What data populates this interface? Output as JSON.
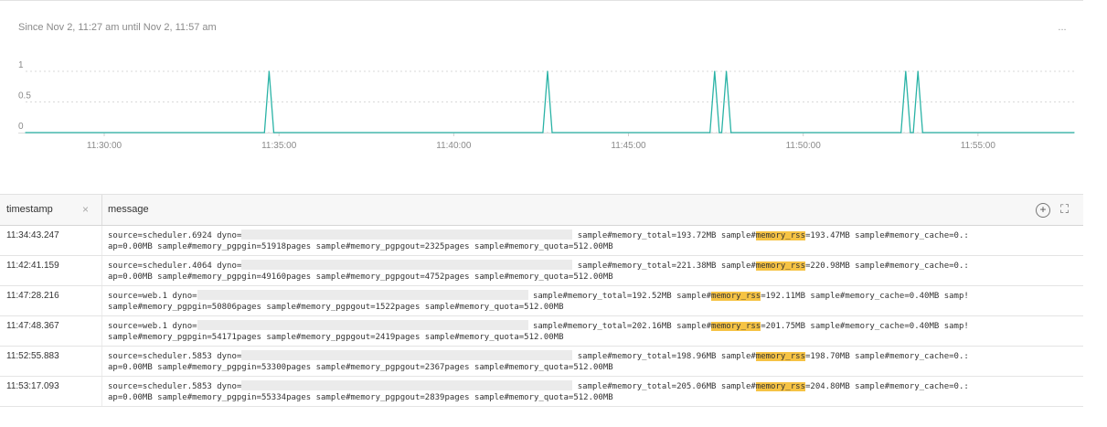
{
  "header": {
    "time_range": "Since Nov 2, 11:27 am until Nov 2, 11:57 am",
    "more_label": "..."
  },
  "chart_data": {
    "type": "line",
    "y_ticks": [
      "1",
      "0.5",
      "0"
    ],
    "x_ticks": [
      "11:30:00",
      "11:35:00",
      "11:40:00",
      "11:45:00",
      "11:50:00",
      "11:55:00"
    ],
    "ylim": [
      0,
      1
    ],
    "grid": true,
    "series_color": "#2ab3a6",
    "x": [
      "11:27:45",
      "11:34:35",
      "11:34:43",
      "11:34:51",
      "11:42:33",
      "11:42:41",
      "11:42:49",
      "11:47:20",
      "11:47:28",
      "11:47:36",
      "11:47:40",
      "11:47:48",
      "11:47:56",
      "11:52:48",
      "11:52:56",
      "11:53:04",
      "11:53:09",
      "11:53:17",
      "11:53:25",
      "11:57:45"
    ],
    "values": [
      0,
      0,
      1,
      0,
      0,
      1,
      0,
      0,
      1,
      0,
      0,
      1,
      0,
      0,
      1,
      0,
      0,
      1,
      0,
      0
    ]
  },
  "table": {
    "columns": {
      "timestamp": "timestamp",
      "remove": "×",
      "message": "message"
    },
    "add_label": "+",
    "expand_label": "⛶",
    "rows": [
      {
        "timestamp": "11:34:43.247",
        "l1_start": "source=scheduler.6924 dyno=",
        "l1_mid": " sample#memory_total=193.72MB sample#",
        "key": "memory_rss",
        "l1_end": "=193.47MB sample#memory_cache=0.:",
        "l2": "ap=0.00MB sample#memory_pgpgin=51918pages sample#memory_pgpgout=2325pages sample#memory_quota=512.00MB"
      },
      {
        "timestamp": "11:42:41.159",
        "l1_start": "source=scheduler.4064 dyno=",
        "l1_mid": " sample#memory_total=221.38MB sample#",
        "key": "memory_rss",
        "l1_end": "=220.98MB sample#memory_cache=0.:",
        "l2": "ap=0.00MB sample#memory_pgpgin=49160pages sample#memory_pgpgout=4752pages sample#memory_quota=512.00MB"
      },
      {
        "timestamp": "11:47:28.216",
        "l1_start": "source=web.1 dyno=",
        "l1_mid": " sample#memory_total=192.52MB sample#",
        "key": "memory_rss",
        "l1_end": "=192.11MB sample#memory_cache=0.40MB samp!",
        "l2": "sample#memory_pgpgin=50806pages sample#memory_pgpgout=1522pages sample#memory_quota=512.00MB"
      },
      {
        "timestamp": "11:47:48.367",
        "l1_start": "source=web.1 dyno=",
        "l1_mid": " sample#memory_total=202.16MB sample#",
        "key": "memory_rss",
        "l1_end": "=201.75MB sample#memory_cache=0.40MB samp!",
        "l2": "sample#memory_pgpgin=54171pages sample#memory_pgpgout=2419pages sample#memory_quota=512.00MB"
      },
      {
        "timestamp": "11:52:55.883",
        "l1_start": "source=scheduler.5853 dyno=",
        "l1_mid": " sample#memory_total=198.96MB sample#",
        "key": "memory_rss",
        "l1_end": "=198.70MB sample#memory_cache=0.:",
        "l2": "ap=0.00MB sample#memory_pgpgin=53300pages sample#memory_pgpgout=2367pages sample#memory_quota=512.00MB"
      },
      {
        "timestamp": "11:53:17.093",
        "l1_start": "source=scheduler.5853 dyno=",
        "l1_mid": " sample#memory_total=205.06MB sample#",
        "key": "memory_rss",
        "l1_end": "=204.80MB sample#memory_cache=0.:",
        "l2": "ap=0.00MB sample#memory_pgpgin=55334pages sample#memory_pgpgout=2839pages sample#memory_quota=512.00MB"
      }
    ]
  }
}
